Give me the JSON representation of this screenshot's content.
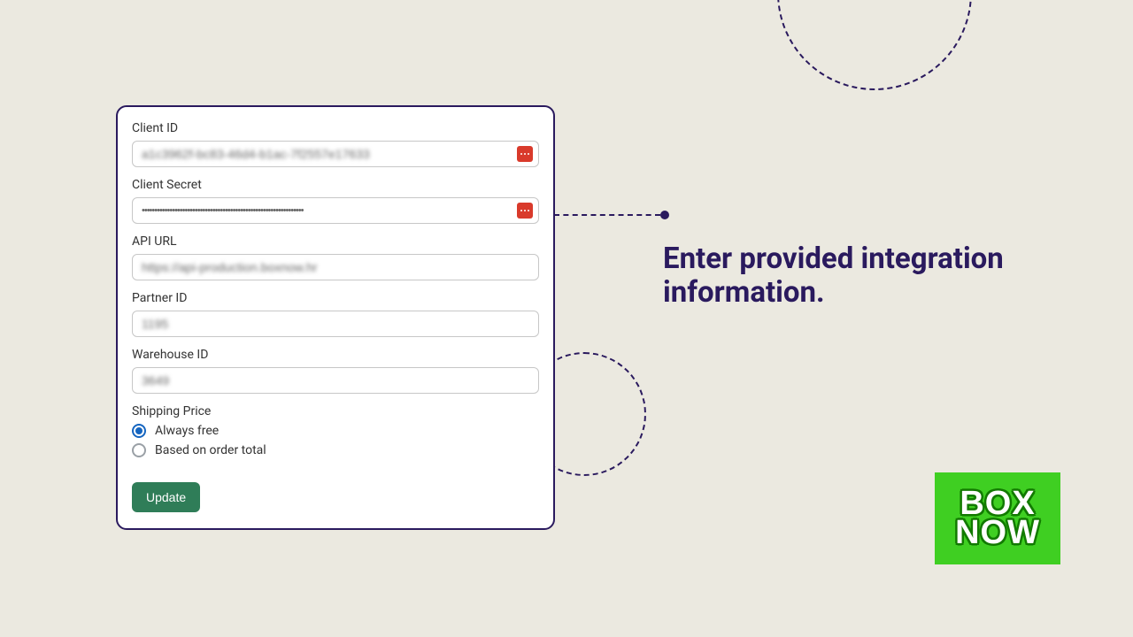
{
  "headline": "Enter provided integration information.",
  "form": {
    "client_id": {
      "label": "Client ID",
      "value": "a1c3962f-bc83-46d4-b1ac-7f2557e17633"
    },
    "client_secret": {
      "label": "Client Secret",
      "value": "••••••••••••••••••••••••••••••••••••••••••••••••••••••••••••••••"
    },
    "api_url": {
      "label": "API URL",
      "value": "https://api-production.boxnow.hr"
    },
    "partner_id": {
      "label": "Partner ID",
      "value": "1195"
    },
    "warehouse_id": {
      "label": "Warehouse ID",
      "value": "3649"
    },
    "shipping_price": {
      "label": "Shipping Price",
      "options": [
        {
          "label": "Always free",
          "selected": true
        },
        {
          "label": "Based on order total",
          "selected": false
        }
      ]
    },
    "submit_label": "Update"
  },
  "logo": {
    "line1": "BOX",
    "line2": "NOW"
  }
}
